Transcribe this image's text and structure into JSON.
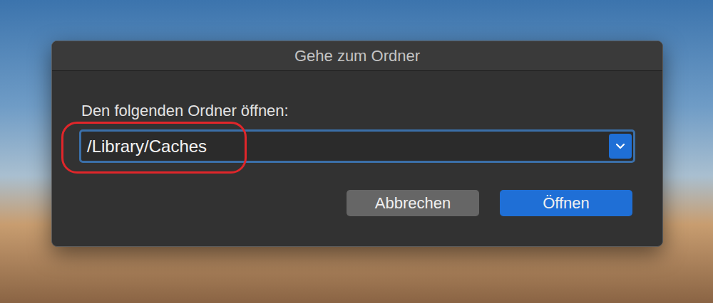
{
  "window": {
    "title": "Gehe zum Ordner"
  },
  "prompt": {
    "label": "Den folgenden Ordner öffnen:"
  },
  "field": {
    "value": "/Library/Caches",
    "focused": true,
    "highlighted": true
  },
  "buttons": [
    {
      "label": "Abbrechen",
      "default": false
    },
    {
      "label": "Öffnen",
      "default": true
    }
  ]
}
